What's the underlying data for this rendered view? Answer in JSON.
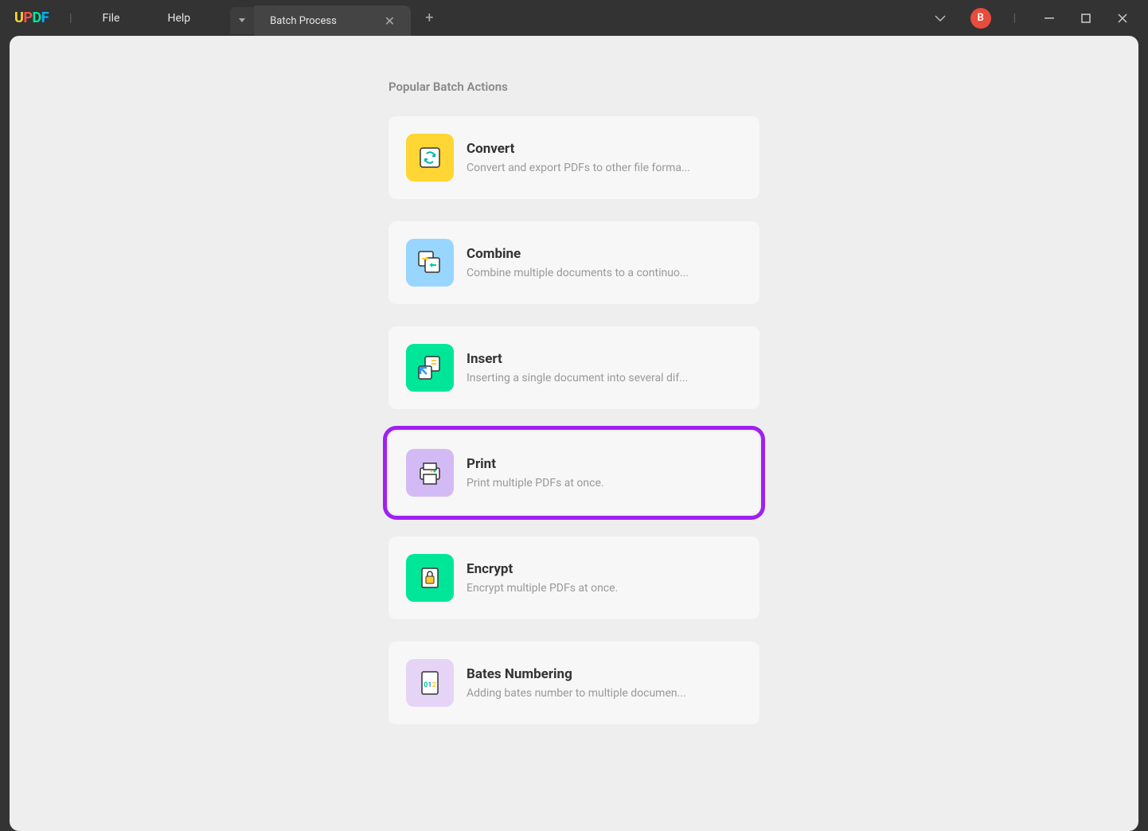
{
  "app": {
    "logo": {
      "u": "U",
      "p": "P",
      "d": "D",
      "f": "F"
    }
  },
  "menu": {
    "file": "File",
    "help": "Help"
  },
  "tabs": {
    "current": "Batch Process"
  },
  "avatar": "B",
  "section_title": "Popular Batch Actions",
  "actions": [
    {
      "title": "Convert",
      "desc": "Convert and export PDFs to other file forma...",
      "icon_bg": "#ffd633",
      "icon": "convert"
    },
    {
      "title": "Combine",
      "desc": "Combine multiple documents to a continuo...",
      "icon_bg": "#99d6ff",
      "icon": "combine"
    },
    {
      "title": "Insert",
      "desc": "Inserting a single document into several dif...",
      "icon_bg": "#00e699",
      "icon": "insert"
    },
    {
      "title": "Print",
      "desc": "Print multiple PDFs at once.",
      "icon_bg": "#d4baf5",
      "icon": "print",
      "highlighted": true
    },
    {
      "title": "Encrypt",
      "desc": "Encrypt multiple PDFs at once.",
      "icon_bg": "#00e699",
      "icon": "encrypt"
    },
    {
      "title": "Bates Numbering",
      "desc": "Adding bates number to multiple documen...",
      "icon_bg": "#e6d4f7",
      "icon": "bates"
    }
  ]
}
